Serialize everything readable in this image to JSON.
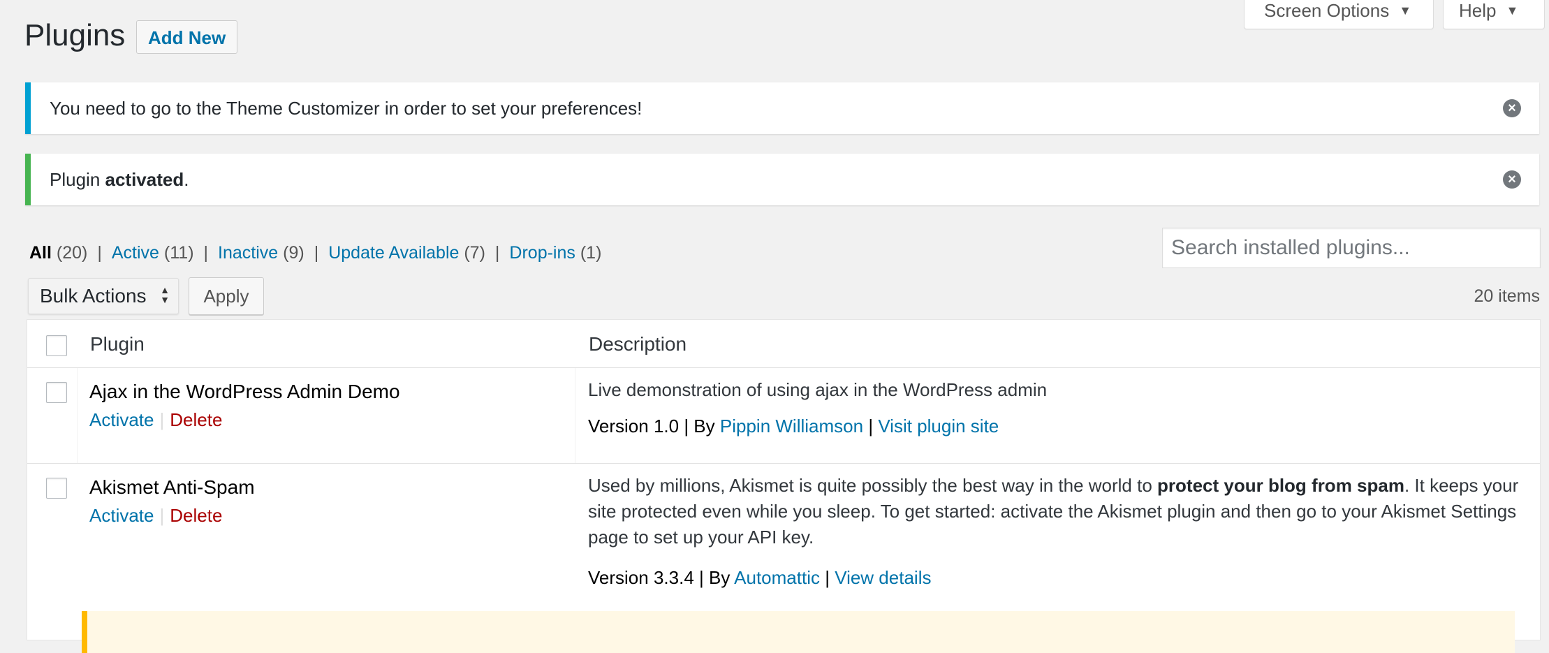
{
  "header": {
    "title": "Plugins",
    "add_new_label": "Add New",
    "screen_options_label": "Screen Options",
    "help_label": "Help"
  },
  "notices": [
    {
      "text": "You need to go to the Theme Customizer in order to set your preferences!",
      "type": "info"
    },
    {
      "text_prefix": "Plugin ",
      "text_strong": "activated",
      "text_suffix": ".",
      "type": "success"
    }
  ],
  "filters": {
    "all": {
      "label": "All",
      "count": "(20)"
    },
    "active": {
      "label": "Active",
      "count": "(11)"
    },
    "inactive": {
      "label": "Inactive",
      "count": "(9)"
    },
    "update": {
      "label": "Update Available",
      "count": "(7)"
    },
    "dropins": {
      "label": "Drop-ins",
      "count": "(1)"
    },
    "separator": "|"
  },
  "search": {
    "placeholder": "Search installed plugins..."
  },
  "bulk": {
    "selected": "Bulk Actions",
    "apply_label": "Apply"
  },
  "items_count": "20 items",
  "table": {
    "col_plugin": "Plugin",
    "col_description": "Description",
    "rows": [
      {
        "name": "Ajax in the WordPress Admin Demo",
        "activate": "Activate",
        "delete": "Delete",
        "description": "Live demonstration of using ajax in the WordPress admin",
        "version": "Version 1.0",
        "by": "| By",
        "author": "Pippin Williamson",
        "sep": "|",
        "link": "Visit plugin site"
      },
      {
        "name": "Akismet Anti-Spam",
        "activate": "Activate",
        "delete": "Delete",
        "desc_part1": "Used by millions, Akismet is quite possibly the best way in the world to ",
        "desc_strong": "protect your blog from spam",
        "desc_part2": ". It keeps your site protected even while you sleep. To get started: activate the Akismet plugin and then go to your Akismet Settings page to set up your API key.",
        "version": "Version 3.3.4",
        "by": "| By",
        "author": "Automattic",
        "sep": "|",
        "link": "View details"
      }
    ]
  },
  "colors": {
    "link": "#0073aa",
    "delete": "#aa0000",
    "info_border": "#00a0d2",
    "success_border": "#46b450",
    "update_border": "#ffb900",
    "background": "#f1f1f1"
  },
  "icons": {
    "dismiss": "close-circle-icon",
    "caret": "caret-down-icon",
    "select_arrows": "up-down-arrows-icon"
  }
}
